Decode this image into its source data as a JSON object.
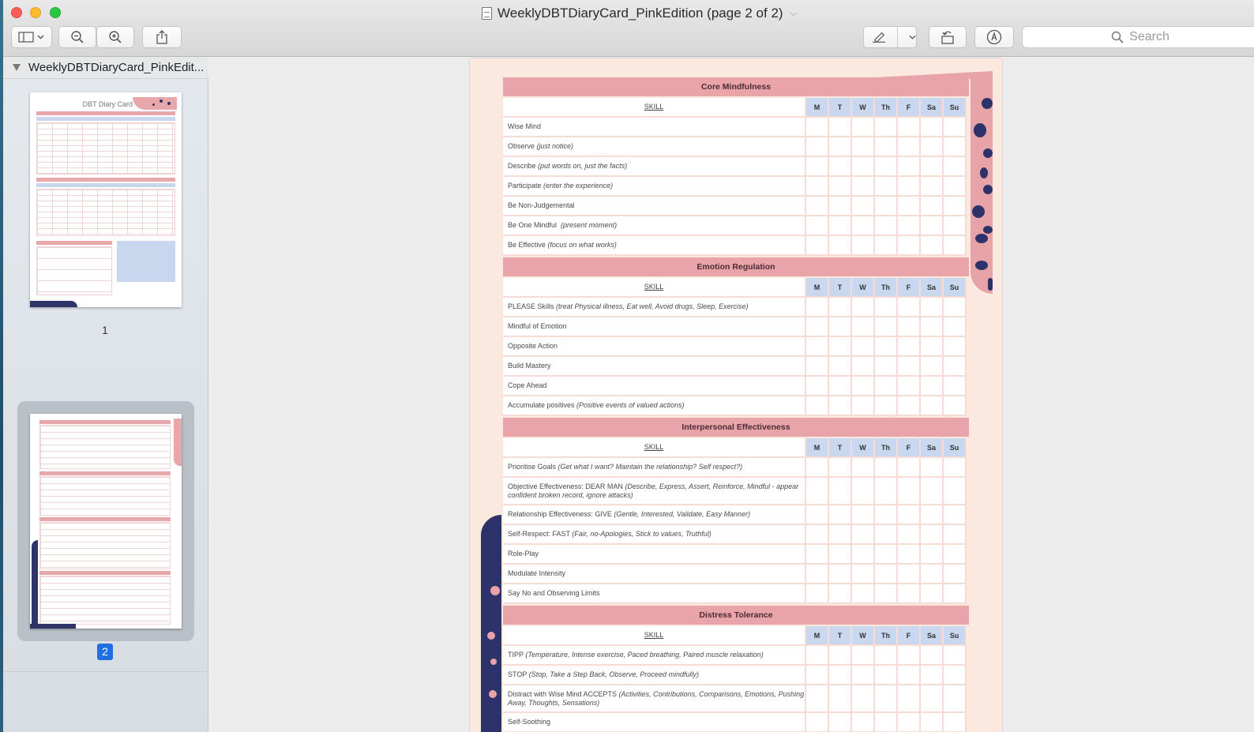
{
  "window": {
    "title": "WeeklyDBTDiaryCard_PinkEdition (page 2 of 2)"
  },
  "toolbar": {
    "search_placeholder": "Search"
  },
  "sidebar": {
    "document_name": "WeeklyDBTDiaryCard_PinkEdit...",
    "pages": [
      {
        "number": "1",
        "mini_title": "DBT Diary Card"
      },
      {
        "number": "2"
      }
    ]
  },
  "document": {
    "days": [
      "M",
      "T",
      "W",
      "Th",
      "F",
      "Sa",
      "Su"
    ],
    "skill_header": "SKILL",
    "sections": [
      {
        "title": "Core Mindfulness",
        "rows": [
          {
            "main": "Wise Mind",
            "note": ""
          },
          {
            "main": "Observe ",
            "note": "(just notice)"
          },
          {
            "main": "Describe ",
            "note": "(put words on, just the facts)"
          },
          {
            "main": "Participate ",
            "note": "(enter the experience)"
          },
          {
            "main": "Be Non-Judgemental",
            "note": ""
          },
          {
            "main": "Be One Mindful ",
            "note": " (present moment)"
          },
          {
            "main": "Be Effective ",
            "note": "(focus on what works)"
          }
        ]
      },
      {
        "title": "Emotion Regulation",
        "rows": [
          {
            "main": "PLEASE Skills ",
            "note": "(treat Physical illness, Eat well, Avoid drugs, Sleep, Exercise)"
          },
          {
            "main": "Mindful of Emotion",
            "note": ""
          },
          {
            "main": "Opposite Action",
            "note": ""
          },
          {
            "main": "Build Mastery",
            "note": ""
          },
          {
            "main": "Cope Ahead",
            "note": ""
          },
          {
            "main": "Accumulate positives ",
            "note": "(Positive events of valued actions)"
          }
        ]
      },
      {
        "title": "Interpersonal Effectiveness",
        "rows": [
          {
            "main": "Prioritise Goals ",
            "note": "(Get what I want? Maintain the relationship? Self respect?)"
          },
          {
            "main": "Objective Effectiveness: DEAR MAN ",
            "note": "(Describe, Express, Assert, Reinforce, Mindful - appear confident broken record, ignore attacks)",
            "tall": true
          },
          {
            "main": "Relationship Effectiveness: GIVE ",
            "note": "(Gentle, Interested, Validate, Easy Manner)"
          },
          {
            "main": "Self-Respect: FAST ",
            "note": "(Fair, no-Apologies, Stick to values, Truthful)"
          },
          {
            "main": "Role-Play",
            "note": ""
          },
          {
            "main": "Modulate Intensity",
            "note": ""
          },
          {
            "main": "Say No and Observing Limits",
            "note": ""
          }
        ]
      },
      {
        "title": "Distress Tolerance",
        "rows": [
          {
            "main": "TIPP ",
            "note": "(Temperature, Intense exercise, Paced breathing, Paired muscle relaxation)"
          },
          {
            "main": "STOP ",
            "note": "(Stop, Take a Step Back, Observe, Proceed mindfully)"
          },
          {
            "main": "Distract with Wise Mind ACCEPTS ",
            "note": "(Activities, Contributions, Comparisons, Emotions, Pushing Away, Thoughts, Sensations)",
            "tall": true
          },
          {
            "main": "Self-Soothing",
            "note": ""
          }
        ]
      }
    ]
  },
  "colors": {
    "section_header": "#e8a4a8",
    "day_header": "#c9d8ef",
    "accent_navy": "#2d336a",
    "page_bg": "#fbe9df",
    "selection_blue": "#1f6fe0"
  }
}
